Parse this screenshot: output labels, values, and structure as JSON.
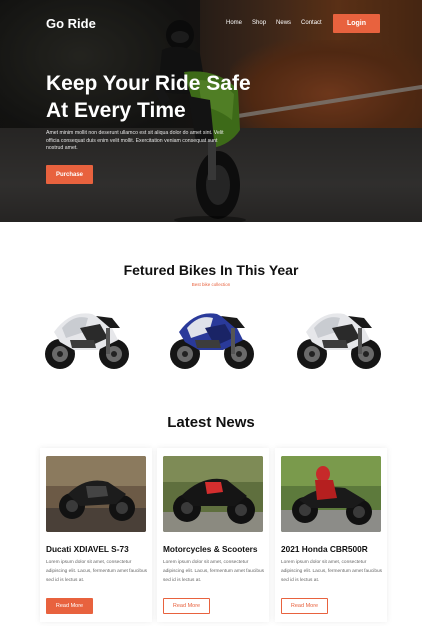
{
  "nav": {
    "logo": "Go Ride",
    "links": [
      "Home",
      "Shop",
      "News",
      "Contact"
    ],
    "login_label": "Login"
  },
  "hero": {
    "title_line1": "Keep Your Ride Safe",
    "title_line2": "At Every Time",
    "description": "Amet minim mollit non deserunt ullamco est sit aliqua dolor do amet sint. Velit officia consequat duis enim velit mollit. Exercitation veniam consequat sunt nostrud amet.",
    "purchase_label": "Purchase"
  },
  "featured": {
    "title": "Fetured Bikes In This Year",
    "subtitle": "Best bike collection",
    "bikes": [
      {
        "icon": "white-sport-bike-image"
      },
      {
        "icon": "blue-sport-bike-image"
      },
      {
        "icon": "white-sport-bike-image"
      }
    ]
  },
  "news": {
    "title": "Latest News",
    "cards": [
      {
        "title": "Ducati XDIAVEL S-73",
        "text": "Lorem ipsum dolor sit amet, consectetur adipiscing elit. Lacus, fermentum amet faucibus sed id is lectus at.",
        "button": "Read More",
        "style": "filled"
      },
      {
        "title": "Motorcycles & Scooters",
        "text": "Lorem ipsum dolor sit amet, consectetur adipiscing elit. Lacus, fermentum amet faucibus sed id is lectus at.",
        "button": "Read More",
        "style": "outline"
      },
      {
        "title": "2021 Honda CBR500R",
        "text": "Lorem ipsum dolor sit amet, consectetur adipiscing elit. Lacus, fermentum amet faucibus sed id is lectus at.",
        "button": "Read More",
        "style": "outline"
      }
    ]
  },
  "colors": {
    "accent": "#e8623e",
    "text_dark": "#111111",
    "text_muted": "#666666"
  }
}
